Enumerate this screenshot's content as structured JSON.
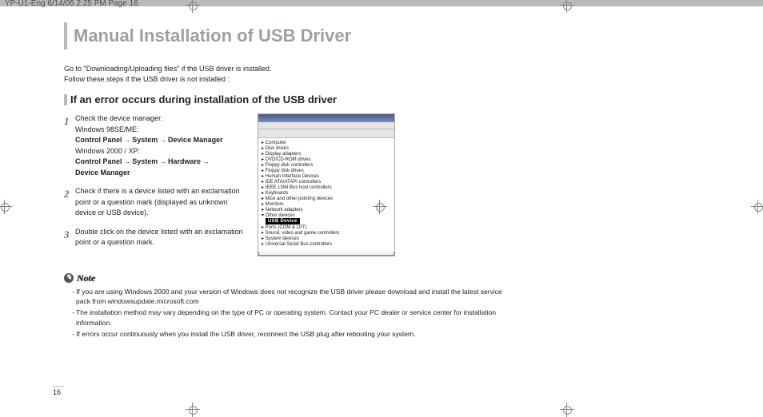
{
  "header": "YP-U1-Eng  6/14/05 2:25 PM  Page 16",
  "title": "Manual Installation of USB Driver",
  "intro_line1": "Go to \"Downloading/Uploading files\" if the USB driver is installed.",
  "intro_line2": "Follow these steps if the USB driver is not installed :",
  "subhead": "If an error occurs during installation of the USB driver",
  "steps": {
    "s1": {
      "num": "1",
      "text": "Check the device manager.",
      "l1": "Windows 98SE/ME:",
      "l2a": "Control Panel",
      "l2b": "System",
      "l2c": "Device Manager",
      "l3": "Windows 2000 / XP:",
      "l4a": "Control Panel",
      "l4b": "System",
      "l4c": "Hardware",
      "l5": "Device Manager"
    },
    "s2": {
      "num": "2",
      "text": "Check if there is a device listed with an exclamation point or a question mark (displayed as unknown device or USB device)."
    },
    "s3": {
      "num": "3",
      "text": "Double click on the device listed with an exclamation point or a question mark."
    }
  },
  "dm": {
    "highlight": "USB Device"
  },
  "note": {
    "label": "Note",
    "items": [
      "- If you are using Windows 2000 and your version of Windows does not recognize the USB driver please download and install the latest service pack from windowsupdate.microsoft.com",
      "- The installation method may vary depending on the type of PC or operating system. Contact your PC dealer or service center for installation information.",
      "- If errors occur continuously when you install the USB driver, reconnect the USB plug after rebooting your system."
    ]
  },
  "page_number": "16"
}
